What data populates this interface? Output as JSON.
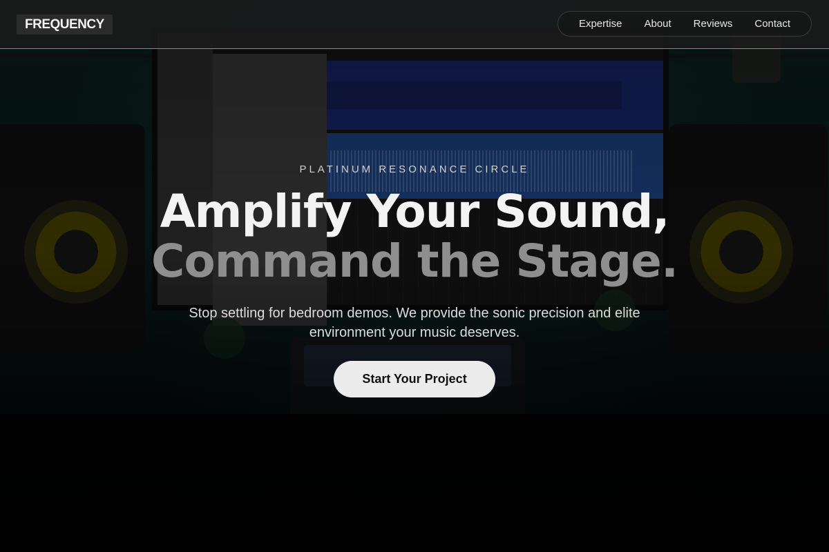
{
  "header": {
    "logo": "FREQUENCY",
    "nav": [
      "Expertise",
      "About",
      "Reviews",
      "Contact"
    ]
  },
  "hero": {
    "eyebrow": "PLATINUM RESONANCE CIRCLE",
    "headline_line1": "Amplify Your Sound,",
    "headline_line2": "Command the Stage.",
    "subtitle": "Stop settling for bedroom demos. We provide the sonic precision and elite environment your music deserves.",
    "cta_label": "Start Your Project"
  },
  "colors": {
    "header_bg": "#1c1c1c",
    "headline_primary": "#f3f3f3",
    "headline_muted": "#8e8e8e",
    "cta_bg": "#ececec",
    "cta_text": "#111111"
  }
}
